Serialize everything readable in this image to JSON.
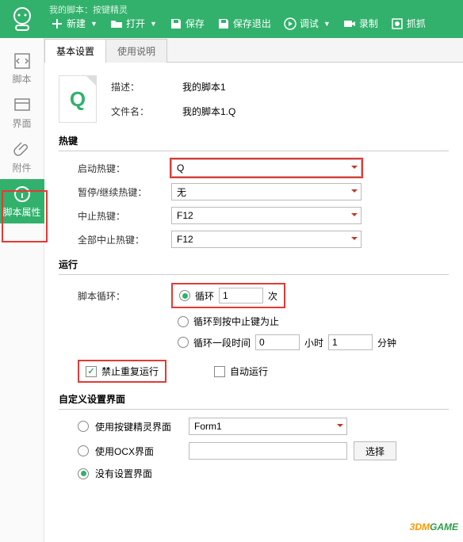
{
  "window": {
    "title": "我的脚本：按键精灵"
  },
  "toolbar": {
    "new": "新建",
    "open": "打开",
    "save": "保存",
    "save_exit": "保存退出",
    "debug": "调试",
    "record": "录制",
    "capture": "抓抓"
  },
  "sidebar": {
    "script": "脚本",
    "ui": "界面",
    "attach": "附件",
    "props": "脚本属性"
  },
  "tabs": {
    "basic": "基本设置",
    "help": "使用说明"
  },
  "meta": {
    "desc_label": "描述：",
    "desc_value": "我的脚本1",
    "file_label": "文件名：",
    "file_value": "我的脚本1.Q",
    "icon_letter": "Q"
  },
  "hotkey": {
    "section": "热键",
    "start_label": "启动热键：",
    "start_value": "Q",
    "pause_label": "暂停/继续热键：",
    "pause_value": "无",
    "stop_label": "中止热键：",
    "stop_value": "F12",
    "stopall_label": "全部中止热键：",
    "stopall_value": "F12"
  },
  "run": {
    "section": "运行",
    "loop_label": "脚本循环：",
    "opt_loop_n_a": "循环",
    "opt_loop_n_val": "1",
    "opt_loop_n_b": "次",
    "opt_loop_stop": "循环到按中止键为止",
    "opt_loop_time_a": "循环一段时间",
    "opt_loop_time_h": "0",
    "opt_loop_time_hl": "小时",
    "opt_loop_time_m": "1",
    "opt_loop_time_ml": "分钟",
    "no_repeat": "禁止重复运行",
    "auto_run": "自动运行"
  },
  "custom": {
    "section": "自定义设置界面",
    "opt_qm": "使用按键精灵界面",
    "qm_value": "Form1",
    "opt_ocx": "使用OCX界面",
    "ocx_value": "",
    "opt_none": "没有设置界面",
    "choose": "选择"
  },
  "watermark": {
    "a": "3DM",
    "b": "GAME"
  }
}
